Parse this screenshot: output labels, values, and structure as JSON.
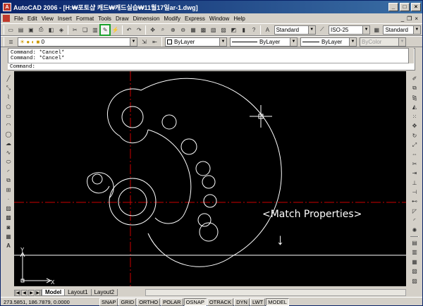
{
  "window": {
    "title": "AutoCAD 2006 - [H:₩포토샵 캐드₩캐드실습₩11월17일ar-1.dwg]",
    "min": "_",
    "max": "□",
    "close": "×"
  },
  "menu": [
    "File",
    "Edit",
    "View",
    "Insert",
    "Format",
    "Tools",
    "Draw",
    "Dimension",
    "Modify",
    "Express",
    "Window",
    "Help"
  ],
  "doc_controls": {
    "min": "_",
    "restore": "❐",
    "close": "×"
  },
  "styles": {
    "text_style": "Standard",
    "dim_style": "ISO-25",
    "table_style": "Standard"
  },
  "layers": {
    "current_layer": "0",
    "color": "ByLayer",
    "linetype": "ByLayer",
    "lineweight": "ByLayer",
    "plotstyle": "ByColor"
  },
  "command": {
    "history": [
      "Command: *Cancel*",
      "Command: *Cancel*"
    ],
    "prompt": "Command:"
  },
  "annotation": {
    "label": "<Match Properties>",
    "arrow": "↓"
  },
  "ucs": {
    "x": "X",
    "y": "Y"
  },
  "tabs": {
    "nav": [
      "|◀",
      "◀",
      "▶",
      "▶|"
    ],
    "items": [
      "Model",
      "Layout1",
      "Layout2"
    ]
  },
  "status": {
    "coords": "273.5851, 186.7879, 0.0000",
    "toggles": [
      "SNAP",
      "GRID",
      "ORTHO",
      "POLAR",
      "OSNAP",
      "OTRACK",
      "DYN",
      "LWT",
      "MODEL"
    ]
  },
  "colors": {
    "canvas": "#000000",
    "crosshair": "#cc0000",
    "geometry": "#ffffff",
    "highlight": "#1aa02c"
  }
}
